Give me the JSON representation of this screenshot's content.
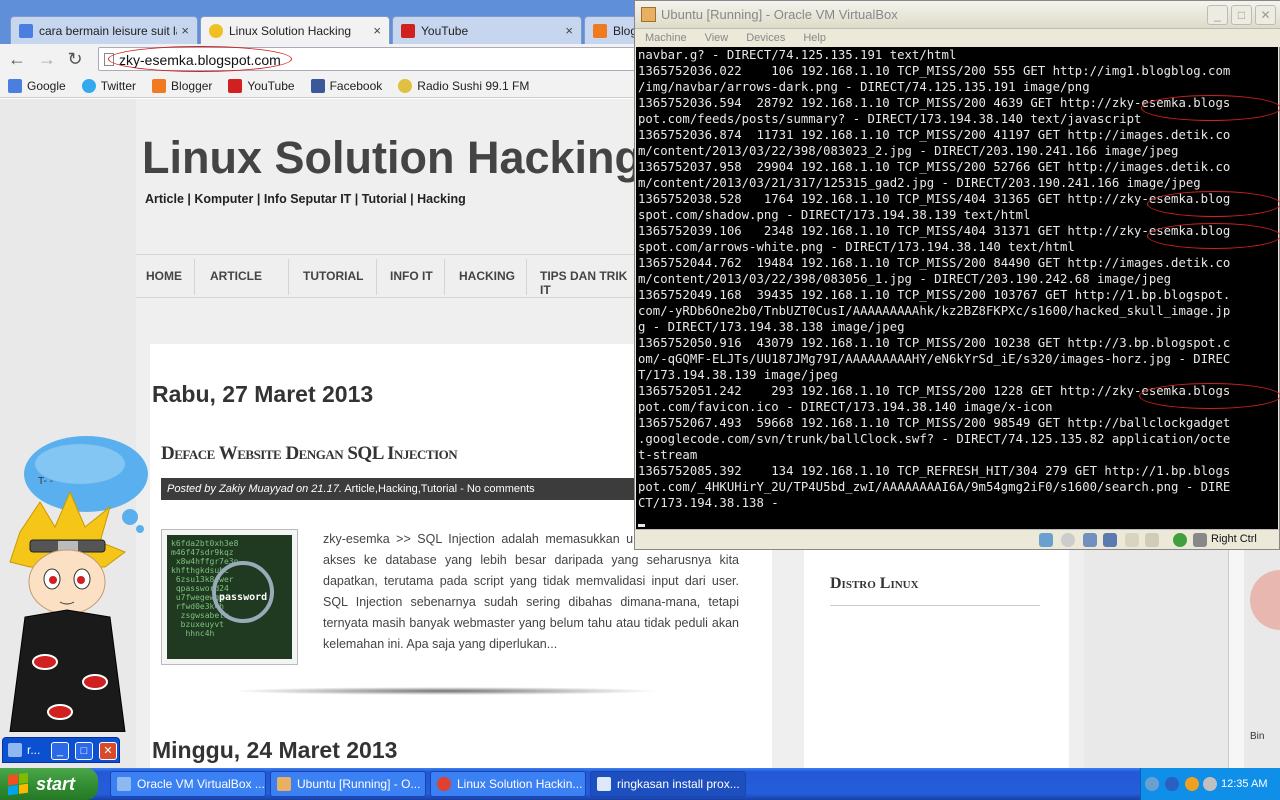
{
  "browser": {
    "tabs": [
      {
        "label": "cara bermain leisure suit larr",
        "icon": "google-icon",
        "active": false
      },
      {
        "label": "Linux Solution Hacking",
        "icon": "radiation-icon",
        "active": true
      },
      {
        "label": "YouTube",
        "icon": "youtube-icon",
        "active": false
      },
      {
        "label": "Blog",
        "icon": "blogger-icon",
        "active": false
      }
    ],
    "close_glyph": "×",
    "url": "zky-esemka.blogspot.com",
    "bookmarks": [
      {
        "label": "Google",
        "icon": "google-icon"
      },
      {
        "label": "Twitter",
        "icon": "twitter-icon"
      },
      {
        "label": "Blogger",
        "icon": "blogger-icon"
      },
      {
        "label": "YouTube",
        "icon": "youtube-icon"
      },
      {
        "label": "Facebook",
        "icon": "facebook-icon"
      },
      {
        "label": "Radio Sushi 99.1 FM",
        "icon": "radio-icon"
      }
    ]
  },
  "blog": {
    "title": "Linux Solution Hacking",
    "description": "Article | Komputer | Info Seputar IT | Tutorial | Hacking",
    "menu": [
      "HOME",
      "ARTICLE",
      "TUTORIAL",
      "INFO IT",
      "HACKING",
      "TIPS DAN TRIK IT"
    ],
    "post_date": "Rabu, 27 Maret 2013",
    "post_title": "Deface Website Dengan SQL Injection",
    "meta_prefix": "Posted by Zakiy Muayyad on 21.17.",
    "meta_labels": "Article,Hacking,Tutorial",
    "meta_comments": "- No comments",
    "thumb_highlight": "password",
    "post_text": "zky-esemka >> SQL Injection adalah memasukkan untuk mendapatkan akses ke database yang lebih besar daripada yang seharusnya kita dapatkan, terutama pada script yang tidak memvalidasi input dari user. SQL Injection sebenarnya sudah sering dibahas dimana-mana, tetapi ternyata masih banyak webmaster yang belum tahu atau tidak peduli akan kelemahan ini. Apa saja yang diperlukan...",
    "next_date": "Minggu, 24 Maret 2013",
    "sidebar_title": "Distro Linux",
    "bin_label": "Bin",
    "mascot_bubble": "T- -"
  },
  "mini_window": {
    "title": "r..."
  },
  "vbox": {
    "title": "Ubuntu [Running] - Oracle VM VirtualBox",
    "menu": [
      "Machine",
      "View",
      "Devices",
      "Help"
    ],
    "host_key": "Right Ctrl",
    "terminal_lines": [
      "navbar.g? - DIRECT/74.125.135.191 text/html",
      "1365752036.022    106 192.168.1.10 TCP_MISS/200 555 GET http://img1.blogblog.com",
      "/img/navbar/arrows-dark.png - DIRECT/74.125.135.191 image/png",
      "1365752036.594  28792 192.168.1.10 TCP_MISS/200 4639 GET http://zky-esemka.blogs",
      "pot.com/feeds/posts/summary? - DIRECT/173.194.38.140 text/javascript",
      "1365752036.874  11731 192.168.1.10 TCP_MISS/200 41197 GET http://images.detik.co",
      "m/content/2013/03/22/398/083023_2.jpg - DIRECT/203.190.241.166 image/jpeg",
      "1365752037.958  29904 192.168.1.10 TCP_MISS/200 52766 GET http://images.detik.co",
      "m/content/2013/03/21/317/125315_gad2.jpg - DIRECT/203.190.241.166 image/jpeg",
      "1365752038.528   1764 192.168.1.10 TCP_MISS/404 31365 GET http://zky-esemka.blog",
      "spot.com/shadow.png - DIRECT/173.194.38.139 text/html",
      "1365752039.106   2348 192.168.1.10 TCP_MISS/404 31371 GET http://zky-esemka.blog",
      "spot.com/arrows-white.png - DIRECT/173.194.38.140 text/html",
      "1365752044.762  19484 192.168.1.10 TCP_MISS/200 84490 GET http://images.detik.co",
      "m/content/2013/03/22/398/083056_1.jpg - DIRECT/203.190.242.68 image/jpeg",
      "1365752049.168  39435 192.168.1.10 TCP_MISS/200 103767 GET http://1.bp.blogspot.",
      "com/-yRDb6One2b0/TnbUZT0CusI/AAAAAAAAAhk/kz2BZ8FKPXc/s1600/hacked_skull_image.jp",
      "g - DIRECT/173.194.38.138 image/jpeg",
      "1365752050.916  43079 192.168.1.10 TCP_MISS/200 10238 GET http://3.bp.blogspot.c",
      "om/-qGQMF-ELJTs/UU187JMg79I/AAAAAAAAAHY/eN6kYrSd_iE/s320/images-horz.jpg - DIREC",
      "T/173.194.38.139 image/jpeg",
      "1365752051.242    293 192.168.1.10 TCP_MISS/200 1228 GET http://zky-esemka.blogs",
      "pot.com/favicon.ico - DIRECT/173.194.38.140 image/x-icon",
      "1365752067.493  59668 192.168.1.10 TCP_MISS/200 98549 GET http://ballclockgadget",
      ".googlecode.com/svn/trunk/ballClock.swf? - DIRECT/74.125.135.82 application/octe",
      "t-stream",
      "1365752085.392    134 192.168.1.10 TCP_REFRESH_HIT/304 279 GET http://1.bp.blogs",
      "pot.com/_4HKUHirY_2U/TP4U5bd_zwI/AAAAAAAAI6A/9m54gmg2iF0/s1600/search.png - DIRE",
      "CT/173.194.38.138 -"
    ]
  },
  "taskbar": {
    "start_label": "start",
    "tasks": [
      {
        "label": "Oracle VM VirtualBox ...",
        "icon": "virtualbox-icon"
      },
      {
        "label": "Ubuntu [Running] - O...",
        "icon": "ubuntu-vm-icon"
      },
      {
        "label": "Linux Solution Hackin...",
        "icon": "chrome-icon"
      },
      {
        "label": "ringkasan install prox...",
        "icon": "document-icon"
      }
    ],
    "clock": "12:35 AM"
  },
  "colors": {
    "annotation_red": "#d02020",
    "xp_blue": "#245edb",
    "terminal_bg": "#000000"
  }
}
